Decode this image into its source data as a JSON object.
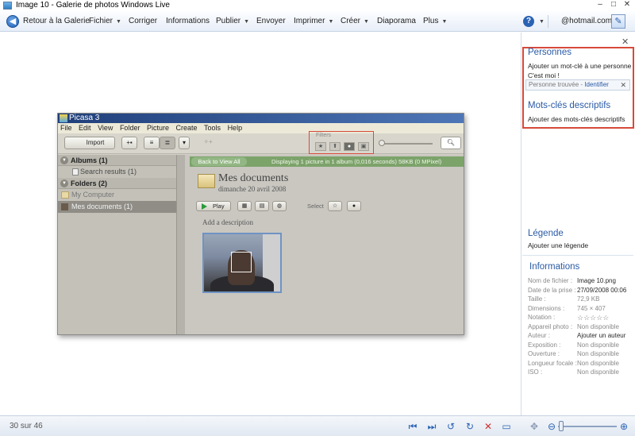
{
  "window": {
    "title": "Image 10 - Galerie de photos Windows Live",
    "controls": [
      "–",
      "□",
      "✕"
    ]
  },
  "menubar": {
    "back_label": "Retour à la Galerie",
    "items": [
      "Fichier",
      "Corriger",
      "Informations",
      "Publier",
      "Envoyer",
      "Imprimer",
      "Créer",
      "Diaporama",
      "Plus"
    ],
    "account": "@hotmail.com",
    "help": "?"
  },
  "picasa": {
    "title": "Picasa 3",
    "menu": [
      "File",
      "Edit",
      "View",
      "Folder",
      "Picture",
      "Create",
      "Tools",
      "Help"
    ],
    "import_label": "Import",
    "filters_label": "Filters",
    "albums_label": "Albums (1)",
    "search_results": "Search results (1)",
    "folders_label": "Folders (2)",
    "my_computer": "My Computer",
    "my_documents": "Mes documents (1)",
    "back_to_all": "Back to View All",
    "display_info": "Displaying 1 picture in 1 album (0,016 seconds) 58KB (0 MPixel)",
    "folder_title": "Mes documents",
    "folder_date": "dimanche 20 avril 2008",
    "play_label": "Play",
    "select_label": "Select",
    "add_description": "Add a description"
  },
  "right_panel": {
    "people_title": "Personnes",
    "add_person_tag": "Ajouter un mot-clé à une personne",
    "its_me": "C'est moi !",
    "person_found": "Personne trouvée - ",
    "identify": "Identifier",
    "tags_title": "Mots-clés descriptifs",
    "add_tags": "Ajouter des mots-clés descriptifs",
    "caption_title": "Légende",
    "add_caption": "Ajouter une légende",
    "info_title": "Informations",
    "info": [
      {
        "key": "Nom de fichier :",
        "value": "Image 10.png",
        "na": false
      },
      {
        "key": "Date de la prise :",
        "value": "27/09/2008 00:06",
        "na": false
      },
      {
        "key": "Taille :",
        "value": "72,9 KB",
        "na": true
      },
      {
        "key": "Dimensions :",
        "value": "745 × 407",
        "na": true
      },
      {
        "key": "Notation :",
        "value": "☆☆☆☆☆",
        "na": true
      },
      {
        "key": "Appareil photo :",
        "value": "Non disponible",
        "na": true
      },
      {
        "key": "Auteur :",
        "value": "Ajouter un auteur",
        "na": false
      },
      {
        "key": "Exposition :",
        "value": "Non disponible",
        "na": true
      },
      {
        "key": "Ouverture :",
        "value": "Non disponible",
        "na": true
      },
      {
        "key": "Longueur focale :",
        "value": "Non disponible",
        "na": true
      },
      {
        "key": "ISO :",
        "value": "Non disponible",
        "na": true
      }
    ]
  },
  "status": {
    "position": "30 sur 46"
  },
  "colors": {
    "accent": "#2a5aa5",
    "highlight": "#d64a3a"
  }
}
